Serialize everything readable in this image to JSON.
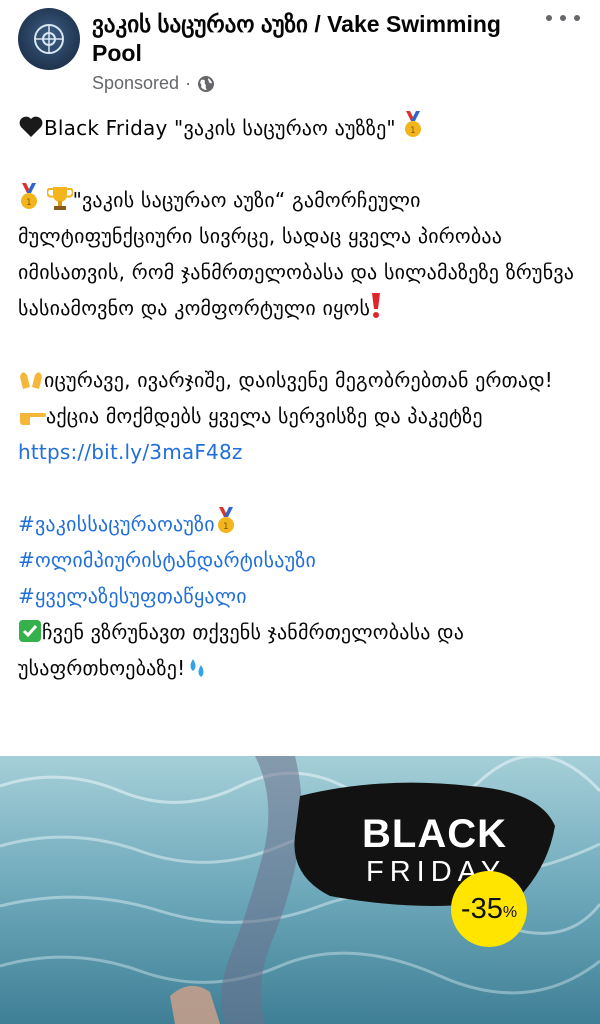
{
  "post": {
    "page_name": "ვაკის საცურაო აუზი / Vake Swimming Pool",
    "sponsored_label": "Sponsored",
    "dot": "·"
  },
  "content": {
    "line1": "Black Friday \"ვაკის საცურაო აუზზე\"",
    "para1": "\"ვაკის საცურაო აუზი“  გამორჩეული მულტიფუნქციური სივრცე, სადაც ყველა პირობაა იმისათვის, რომ ჯანმრთელობასა და სილამაზეზე ზრუნვა სასიამოვნო და კომფორტული იყოს",
    "para2a": "იცურავე, ივარჯიშე, დაისვენე მეგობრებთან ერთად!",
    "para2b_text": "აქცია მოქმდებს ყველა სერვისზე და პაკეტზე",
    "link": "https://bit.ly/3maF48z",
    "hashtag1": "#ვაკისსაცურაოაუზი",
    "hashtag2": "#ოლიმპიურისტანდარტისაუზი",
    "hashtag3": "#ყველაზესუფთაწყალი",
    "closing": "ჩვენ ვზრუნავთ თქვენს ჯანმრთელობასა და  უსაფრთხოებაზე!"
  },
  "media": {
    "black": "BLACK",
    "friday": "FRIDAY",
    "discount_value": "-35",
    "discount_unit": "%"
  },
  "icons": {
    "heart": "black-heart-icon",
    "medal": "medal-icon",
    "trophy": "trophy-icon",
    "exclamation": "red-exclamation-icon",
    "hands": "raised-hands-icon",
    "pointing": "pointing-hand-icon",
    "check": "check-mark-icon",
    "droplets": "droplets-icon",
    "globe": "globe-icon",
    "more": "more-options-icon"
  },
  "colors": {
    "link": "#216fdb",
    "meta": "#65676b",
    "discount_badge": "#ffe500"
  }
}
